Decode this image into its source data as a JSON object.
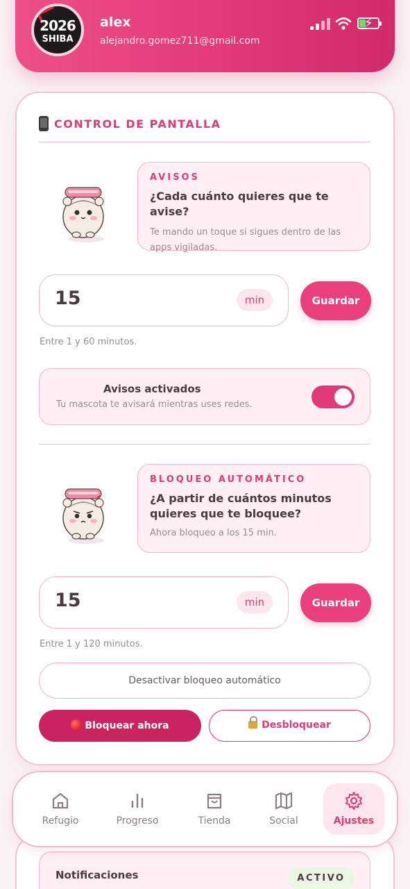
{
  "header": {
    "avatar_line1": "2026",
    "avatar_line2": "SHIBA",
    "user_name": "alex",
    "user_email": "alejandro.gomez711@gmail.com"
  },
  "screen_control": {
    "title": "CONTROL DE PANTALLA",
    "warnings": {
      "tag": "AVISOS",
      "question": "¿Cada cuánto quieres que te avise?",
      "description": "Te mando un toque si sigues dentro de las apps vigiladas.",
      "value": "15",
      "unit": "min",
      "save_label": "Guardar",
      "hint": "Entre 1 y 60 minutos."
    },
    "toggle": {
      "title": "Avisos activados",
      "subtitle": "Tu mascota te avisará mientras uses redes.",
      "enabled": true
    },
    "auto_lock": {
      "tag": "BLOQUEO AUTOMÁTICO",
      "question": "¿A partir de cuántos minutos quieres que te bloquee?",
      "description": "Ahora bloqueo a los 15 min.",
      "value": "15",
      "unit": "min",
      "save_label": "Guardar",
      "hint": "Entre 1 y 120 minutos."
    },
    "disable_auto_lock_label": "Desactivar bloqueo automático",
    "block_now_label": "Bloquear ahora",
    "unblock_label": "Desbloquear"
  },
  "notifications": {
    "label": "Notificaciones",
    "badge": "ACTIVO"
  },
  "nav": {
    "items": [
      {
        "label": "Refugio",
        "icon": "home-icon"
      },
      {
        "label": "Progreso",
        "icon": "bar-chart-icon"
      },
      {
        "label": "Tienda",
        "icon": "shopping-bag-icon"
      },
      {
        "label": "Social",
        "icon": "map-icon"
      },
      {
        "label": "Ajustes",
        "icon": "gear-icon",
        "active": true
      }
    ]
  },
  "colors": {
    "accent": "#e23a78",
    "accent_dark": "#c9245f",
    "soft_pink": "#fff0f5",
    "border_pink": "#f4b6cc",
    "success_bg": "#eaf6e1"
  }
}
